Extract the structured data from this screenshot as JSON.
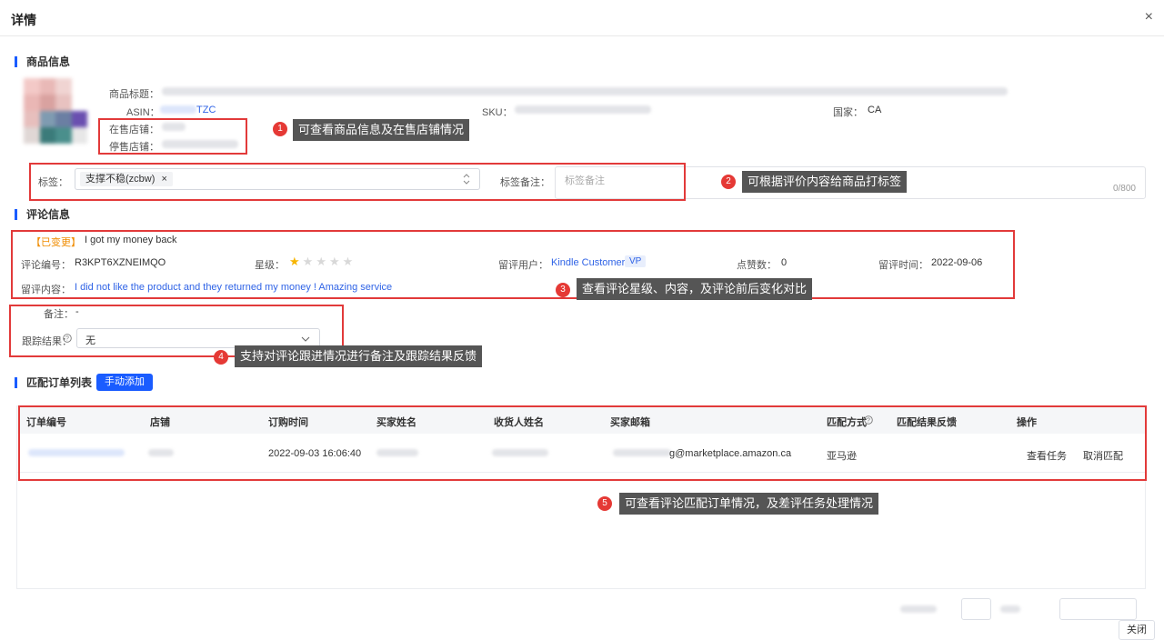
{
  "dialog": {
    "title": "详情",
    "close_icon": "×",
    "close_button": "关闭"
  },
  "product": {
    "section_title": "商品信息",
    "title_label": "商品标题：",
    "asin_label": "ASIN：",
    "asin_suffix": "TZC",
    "sku_label": "SKU：",
    "country_label": "国家：",
    "country_value": "CA",
    "on_sale_label": "在售店铺：",
    "off_sale_label": "停售店铺："
  },
  "tags": {
    "label": "标签：",
    "chip": "支撑不稳(zcbw)",
    "chip_remove": "×",
    "note_label": "标签备注：",
    "note_placeholder": "标签备注",
    "counter": "0/800"
  },
  "review": {
    "section_title": "评论信息",
    "status_badge": "【已变更】",
    "headline": "I got my money back",
    "id_label": "评论编号：",
    "id_value": "R3KPT6XZNEIMQO",
    "rating_label": "星级：",
    "rating": 1,
    "rating_max": 5,
    "user_label": "留评用户：",
    "user_value": "Kindle Customer",
    "user_badge": "VP",
    "likes_label": "点赞数：",
    "likes_value": "0",
    "time_label": "留评时间：",
    "time_value": "2022-09-06",
    "content_label": "留评内容：",
    "content_value": "I did not like the product and they returned my money ! Amazing service"
  },
  "followup": {
    "note_label": "备注：",
    "note_value": "-",
    "result_label": "跟踪结果：",
    "result_value": "无"
  },
  "orders": {
    "section_title": "匹配订单列表",
    "add_button": "手动添加",
    "columns": [
      "订单编号",
      "店铺",
      "订购时间",
      "买家姓名",
      "收货人姓名",
      "买家邮箱",
      "匹配方式",
      "匹配结果反馈",
      "操作"
    ],
    "rows": [
      {
        "order_time": "2022-09-03 16:06:40",
        "email_suffix": "g@marketplace.amazon.ca",
        "match_method": "亚马逊",
        "action_view": "查看任务",
        "action_cancel": "取消匹配"
      }
    ]
  },
  "callouts": [
    {
      "num": "1",
      "text": "可查看商品信息及在售店铺情况"
    },
    {
      "num": "2",
      "text": "可根据评价内容给商品打标签"
    },
    {
      "num": "3",
      "text": "查看评论星级、内容，及评论前后变化对比"
    },
    {
      "num": "4",
      "text": "支持对评论跟进情况进行备注及跟踪结果反馈"
    },
    {
      "num": "5",
      "text": "可查看评论匹配订单情况，及差评任务处理情况"
    }
  ],
  "colors": {
    "accent": "#1a5cff",
    "annotation_red": "#e23a3a",
    "callout_bg": "#555555",
    "link": "#2f63e6",
    "badge_orange": "#f08c00"
  }
}
